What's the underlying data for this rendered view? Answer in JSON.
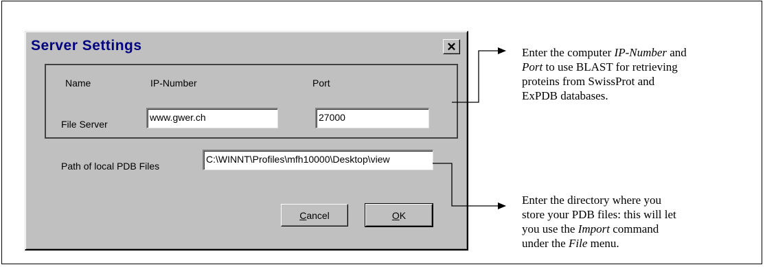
{
  "dialog": {
    "title": "Server Settings",
    "close_glyph": "✕",
    "columns": {
      "name": "Name",
      "ip": "IP-Number",
      "port": "Port"
    },
    "row_label": "File Server",
    "ip_value": "www.gwer.ch",
    "port_value": "27000",
    "path_label": "Path of local PDB Files",
    "path_value": "C:\\WINNT\\Profiles\\mfh10000\\Desktop\\view",
    "cancel_label": {
      "accel": "C",
      "rest": "ancel"
    },
    "ok_label": {
      "accel": "O",
      "rest": "K"
    }
  },
  "annotations": {
    "top": {
      "line1_pre": "Enter the computer ",
      "line1_em": "IP-Number",
      "line1_post": " and",
      "line2_em": "Port",
      "line2_post": " to use BLAST for retrieving",
      "line3": "proteins from SwissProt and",
      "line4": "ExPDB databases."
    },
    "bottom": {
      "line1": "Enter the directory where you",
      "line2": "store your PDB files: this will let",
      "line3_pre": "you use the ",
      "line3_em": "Import",
      "line3_post": " command",
      "line4_pre": "under the ",
      "line4_em": "File",
      "line4_post": " menu."
    }
  },
  "colors": {
    "dialog_bg": "#c0c0c0",
    "title_text": "#000080"
  }
}
